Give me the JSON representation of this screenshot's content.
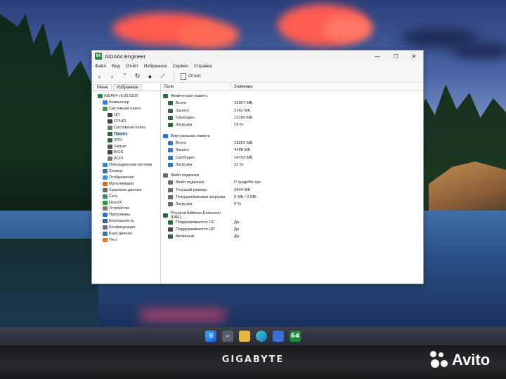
{
  "taskbar": {
    "icons": [
      "windows-icon",
      "search-icon",
      "file-explorer-icon",
      "edge-icon",
      "store-icon",
      "aida64-icon"
    ],
    "aida_label": "64"
  },
  "bezel": {
    "brand": "GIGABYTE"
  },
  "watermark": {
    "text": "Avito"
  },
  "window": {
    "title": "AIDA64 Engineer",
    "app_icon_text": "64",
    "controls": {
      "minimize": "—",
      "maximize": "☐",
      "close": "✕"
    },
    "menu": [
      "Файл",
      "Вид",
      "Отчёт",
      "Избранное",
      "Сервис",
      "Справка"
    ],
    "toolbar": {
      "report_label": "Отчёт"
    },
    "left_tabs": {
      "menu": "Меню",
      "favorites": "Избранное"
    },
    "tree": [
      {
        "label": "AIDA64 v6.00.5100",
        "indent": 0,
        "arrow": "",
        "icon": "#1f8a3a"
      },
      {
        "label": "Компьютер",
        "indent": 1,
        "arrow": "›",
        "icon": "#3a7bd5"
      },
      {
        "label": "Системная плата",
        "indent": 1,
        "arrow": "⌄",
        "icon": "#5a8a5a"
      },
      {
        "label": "ЦП",
        "indent": 2,
        "arrow": "",
        "icon": "#444444"
      },
      {
        "label": "CPUID",
        "indent": 2,
        "arrow": "",
        "icon": "#444444"
      },
      {
        "label": "Системная плата",
        "indent": 2,
        "arrow": "",
        "icon": "#5a8a5a"
      },
      {
        "label": "Память",
        "indent": 2,
        "arrow": "",
        "icon": "#2a6a3a",
        "selected": true
      },
      {
        "label": "SPD",
        "indent": 2,
        "arrow": "",
        "icon": "#2a6a3a"
      },
      {
        "label": "Чипсет",
        "indent": 2,
        "arrow": "",
        "icon": "#555555"
      },
      {
        "label": "BIOS",
        "indent": 2,
        "arrow": "",
        "icon": "#444444"
      },
      {
        "label": "ACPI",
        "indent": 2,
        "arrow": "",
        "icon": "#777777"
      },
      {
        "label": "Операционная система",
        "indent": 1,
        "arrow": "›",
        "icon": "#2a8ae0"
      },
      {
        "label": "Сервер",
        "indent": 1,
        "arrow": "›",
        "icon": "#4a6a9a"
      },
      {
        "label": "Отображение",
        "indent": 1,
        "arrow": "›",
        "icon": "#3a9ad0"
      },
      {
        "label": "Мультимедиа",
        "indent": 1,
        "arrow": "›",
        "icon": "#c07030"
      },
      {
        "label": "Хранение данных",
        "indent": 1,
        "arrow": "›",
        "icon": "#6a6a6a"
      },
      {
        "label": "Сеть",
        "indent": 1,
        "arrow": "›",
        "icon": "#3a8a6a"
      },
      {
        "label": "DirectX",
        "indent": 1,
        "arrow": "›",
        "icon": "#2a9a3a"
      },
      {
        "label": "Устройства",
        "indent": 1,
        "arrow": "›",
        "icon": "#7a7a7a"
      },
      {
        "label": "Программы",
        "indent": 1,
        "arrow": "›",
        "icon": "#3a6ad0"
      },
      {
        "label": "Безопасность",
        "indent": 1,
        "arrow": "›",
        "icon": "#3a5aa0"
      },
      {
        "label": "Конфигурация",
        "indent": 1,
        "arrow": "›",
        "icon": "#6a6a9a"
      },
      {
        "label": "База данных",
        "indent": 1,
        "arrow": "›",
        "icon": "#3a7aa0"
      },
      {
        "label": "Тест",
        "indent": 1,
        "arrow": "›",
        "icon": "#d08030"
      }
    ],
    "columns": {
      "field": "Поле",
      "value": "Значение"
    },
    "sections": [
      {
        "title": "Физическая память",
        "icon": "#2a6a3a",
        "rows": [
          {
            "field": "Всего",
            "value": "16307 МБ",
            "icon": "#2a6a3a"
          },
          {
            "field": "Занято",
            "value": "3142 МБ",
            "icon": "#2a6a3a"
          },
          {
            "field": "Свободно",
            "value": "13165 МБ",
            "icon": "#2a6a3a"
          },
          {
            "field": "Загрузка",
            "value": "19 %",
            "icon": "#2a6a3a"
          }
        ]
      },
      {
        "title": "Виртуальная память",
        "icon": "#2a7ad0",
        "rows": [
          {
            "field": "Всего",
            "value": "19251 МБ",
            "icon": "#2a7ad0"
          },
          {
            "field": "Занято",
            "value": "4498 МБ",
            "icon": "#2a7ad0"
          },
          {
            "field": "Свободно",
            "value": "14753 МБ",
            "icon": "#2a7ad0"
          },
          {
            "field": "Загрузка",
            "value": "23 %",
            "icon": "#2a7ad0"
          }
        ]
      },
      {
        "title": "Файл подкачки",
        "icon": "#6a6a6a",
        "rows": [
          {
            "field": "Файл подкачки",
            "value": "C:\\pagefile.sys",
            "icon": "#6a6a6a"
          },
          {
            "field": "Текущий размер",
            "value": "2944 МБ",
            "icon": "#6a6a6a"
          },
          {
            "field": "Текущая/пиковая загрузка",
            "value": "0 МБ / 0 МБ",
            "icon": "#6a6a6a"
          },
          {
            "field": "Загрузка",
            "value": "0 %",
            "icon": "#6a6a6a"
          }
        ]
      },
      {
        "title": "Physical Address Extension (PAE)",
        "icon": "#2a6a3a",
        "rows": [
          {
            "field": "Поддерживается ОС",
            "value": "Да",
            "icon": "#2a6a3a"
          },
          {
            "field": "Поддерживается ЦП",
            "value": "Да",
            "icon": "#444444"
          },
          {
            "field": "Активный",
            "value": "Да",
            "icon": "#2a6a3a"
          }
        ]
      }
    ]
  }
}
